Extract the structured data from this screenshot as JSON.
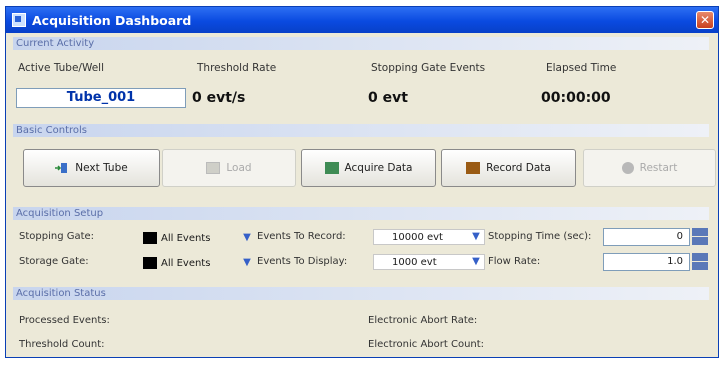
{
  "window": {
    "title": "Acquisition Dashboard",
    "close_glyph": "✕"
  },
  "current_activity": {
    "header": "Current Activity",
    "active_tube_label": "Active Tube/Well",
    "active_tube_value": "Tube_001",
    "threshold_rate_label": "Threshold Rate",
    "threshold_rate_value": "0 evt/s",
    "stopping_gate_events_label": "Stopping Gate Events",
    "stopping_gate_events_value": "0 evt",
    "elapsed_time_label": "Elapsed Time",
    "elapsed_time_value": "00:00:00"
  },
  "basic_controls": {
    "header": "Basic Controls",
    "next_tube": "Next Tube",
    "load": "Load",
    "acquire_data": "Acquire Data",
    "record_data": "Record Data",
    "restart": "Restart",
    "colors": {
      "acquire": "#3f8c55",
      "record": "#9a5b14"
    }
  },
  "acquisition_setup": {
    "header": "Acquisition Setup",
    "stopping_gate_label": "Stopping Gate:",
    "stopping_gate_value": "All Events",
    "storage_gate_label": "Storage Gate:",
    "storage_gate_value": "All Events",
    "events_to_record_label": "Events To Record:",
    "events_to_record_value": "10000 evt",
    "events_to_display_label": "Events To Display:",
    "events_to_display_value": "1000 evt",
    "stopping_time_label": "Stopping Time (sec):",
    "stopping_time_value": "0",
    "flow_rate_label": "Flow Rate:",
    "flow_rate_value": "1.0"
  },
  "acquisition_status": {
    "header": "Acquisition Status",
    "processed_events_label": "Processed Events:",
    "threshold_count_label": "Threshold Count:",
    "electronic_abort_rate_label": "Electronic Abort Rate:",
    "electronic_abort_count_label": "Electronic Abort Count:"
  }
}
